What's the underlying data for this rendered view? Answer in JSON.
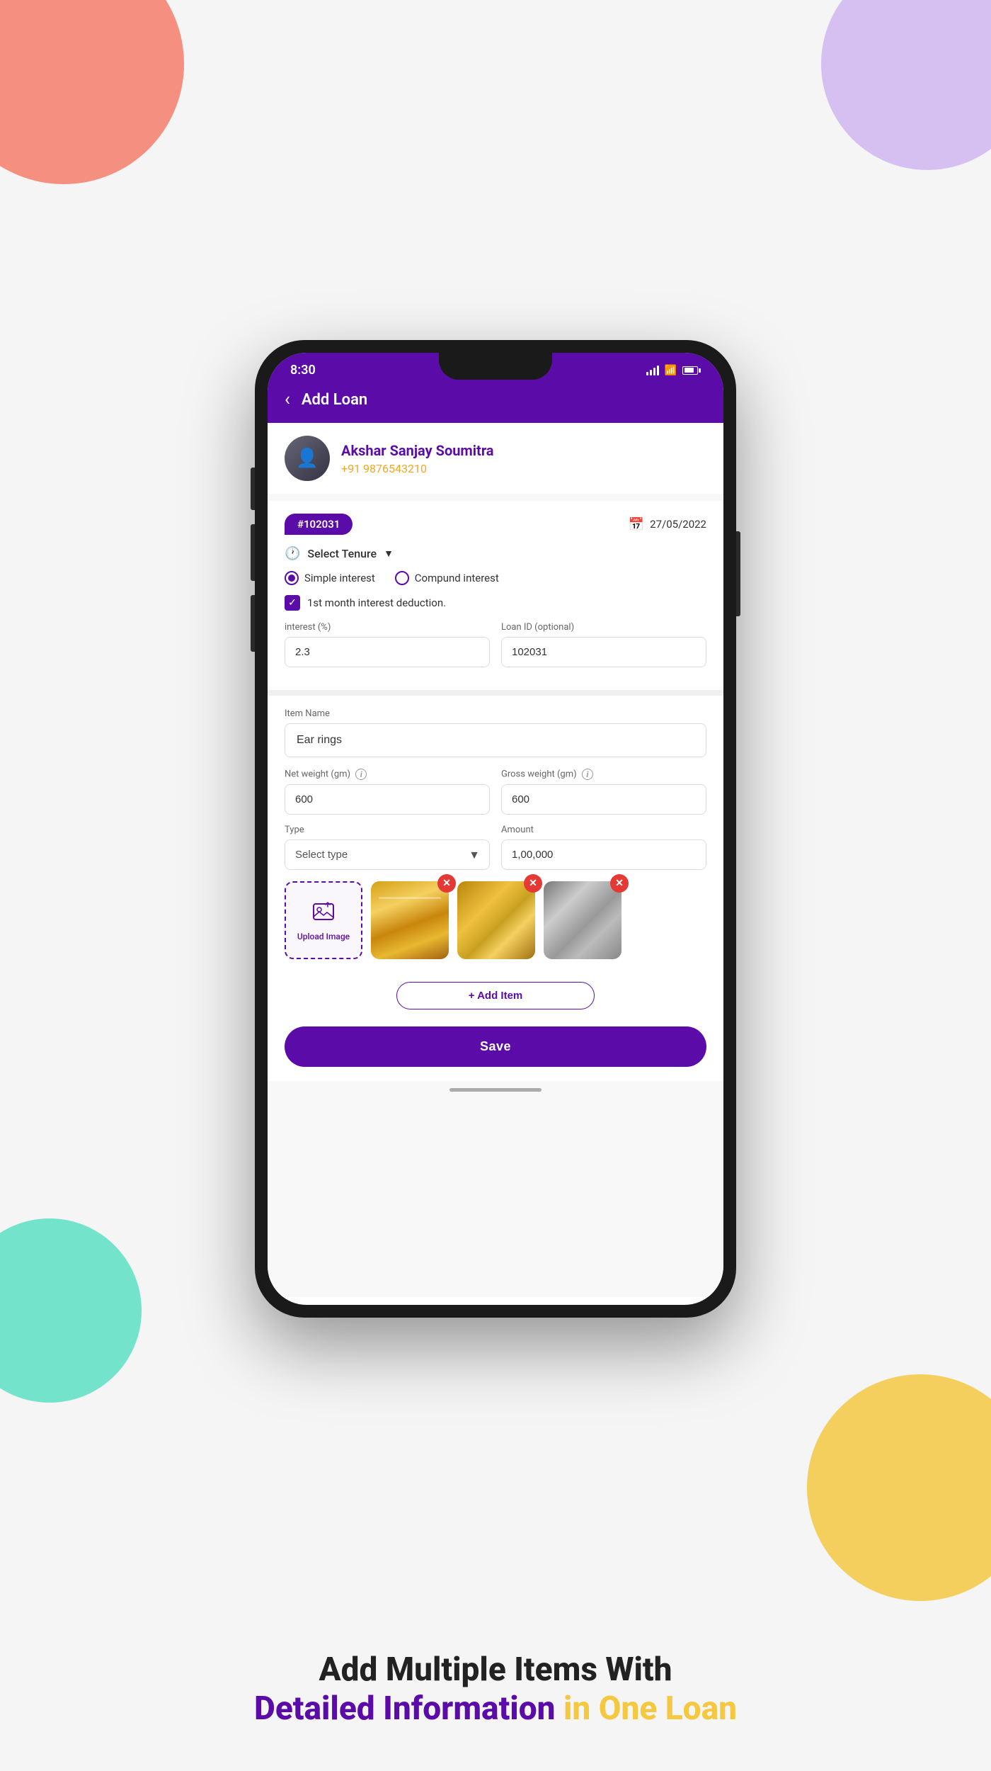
{
  "background": {
    "coral_circle": "coral decorative circle top left",
    "purple_circle": "purple decorative circle top right",
    "green_circle": "green decorative circle bottom left",
    "yellow_circle": "yellow decorative circle bottom right"
  },
  "status_bar": {
    "time": "8:30",
    "signal": "signal bars",
    "wifi": "wifi",
    "battery": "battery"
  },
  "header": {
    "back_label": "‹",
    "title": "Add Loan"
  },
  "user": {
    "name": "Akshar Sanjay Soumitra",
    "phone": "+91 9876543210"
  },
  "loan": {
    "id": "#102031",
    "date": "27/05/2022",
    "tenure_label": "Select Tenure",
    "interest_type_simple": "Simple interest",
    "interest_type_compound": "Compund interest",
    "checkbox_label": "1st month interest deduction.",
    "interest_label": "interest (%)",
    "interest_value": "2.3",
    "loan_id_label": "Loan ID (optional)",
    "loan_id_value": "102031"
  },
  "item": {
    "item_name_label": "Item Name",
    "item_name_value": "Ear rings",
    "net_weight_label": "Net weight (gm)",
    "net_weight_value": "600",
    "gross_weight_label": "Gross weight (gm)",
    "gross_weight_value": "600",
    "type_label": "Type",
    "type_placeholder": "Select type",
    "amount_label": "Amount",
    "amount_value": "1,00,000"
  },
  "upload": {
    "label": "Upload Image"
  },
  "buttons": {
    "add_item": "+ Add Item",
    "save": "Save"
  },
  "bottom_text": {
    "line1": "Add Multiple Items With",
    "line2_part1": "Detailed Information ",
    "line2_part2": "in One Loan"
  }
}
